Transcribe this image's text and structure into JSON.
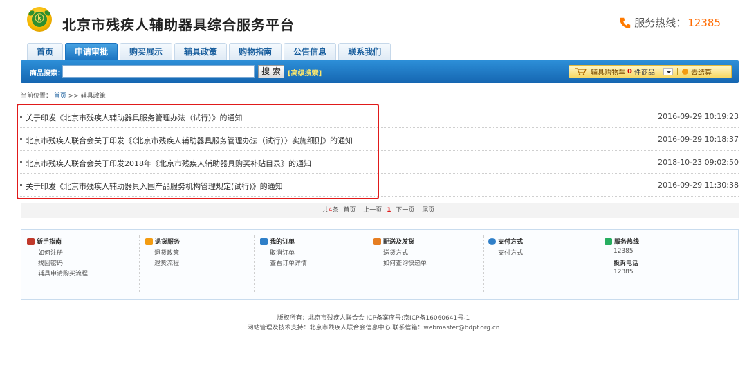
{
  "header": {
    "site_title": "北京市残疾人辅助器具综合服务平台",
    "hotline_label": "服务热线：",
    "hotline_number": "12385"
  },
  "nav": {
    "tabs": [
      {
        "label": "首页"
      },
      {
        "label": "申请审批"
      },
      {
        "label": "购买展示"
      },
      {
        "label": "辅具政策"
      },
      {
        "label": "购物指南"
      },
      {
        "label": "公告信息"
      },
      {
        "label": "联系我们"
      }
    ],
    "active_index": 1
  },
  "search": {
    "label": "商品搜索：",
    "value": "",
    "button": "搜 索",
    "advanced": "[高级搜索]"
  },
  "cart": {
    "label": "辅具购物车",
    "count": "0",
    "unit": "件商品",
    "checkout": "去结算"
  },
  "breadcrumb": {
    "prefix": "当前位置：",
    "home": "首页",
    "sep": ">>",
    "current": "辅具政策"
  },
  "articles": [
    {
      "title": "关于印发《北京市残疾人辅助器具服务管理办法（试行）》的通知",
      "date": "2016-09-29 10:19:23"
    },
    {
      "title": "北京市残疾人联合会关于印发《〈北京市残疾人辅助器具服务管理办法（试行）〉实施细则》的通知",
      "date": "2016-09-29 10:18:37"
    },
    {
      "title": "北京市残疾人联合会关于印发2018年《北京市残疾人辅助器具购买补贴目录》的通知",
      "date": "2018-10-23 09:02:50"
    },
    {
      "title": "关于印发《北京市残疾人辅助器具入围产品服务机构管理规定(试行)》的通知",
      "date": "2016-09-29 11:30:38"
    }
  ],
  "pager": {
    "total_prefix": "共",
    "total": "4",
    "total_suffix": "条",
    "first": "首页",
    "prev": "上一页",
    "current": "1",
    "next": "下一页",
    "last": "尾页"
  },
  "footer": {
    "columns": [
      {
        "title": "新手指南",
        "items": [
          "如何注册",
          "找回密码",
          "辅具申请购买流程"
        ]
      },
      {
        "title": "退货服务",
        "items": [
          "退货政策",
          "退货流程"
        ]
      },
      {
        "title": "我的订单",
        "items": [
          "取消订单",
          "查看订单详情"
        ]
      },
      {
        "title": "配送及发货",
        "items": [
          "送货方式",
          "如何查询快递单"
        ]
      },
      {
        "title": "支付方式",
        "items": [
          "支付方式"
        ]
      },
      {
        "title": "服务热线",
        "items": [
          "12385",
          "投诉电话",
          "12385"
        ]
      }
    ],
    "copyright_line1": "版权所有：北京市残疾人联合会    ICP备案序号:京ICP备16060641号-1",
    "copyright_line2": "网站管理及技术支持：北京市残疾人联合会信息中心    联系信箱：webmaster@bdpf.org.cn"
  },
  "colors": {
    "brand_blue": "#1566b1",
    "accent_orange": "#ff6a00",
    "highlight_red": "#e01a1a"
  }
}
